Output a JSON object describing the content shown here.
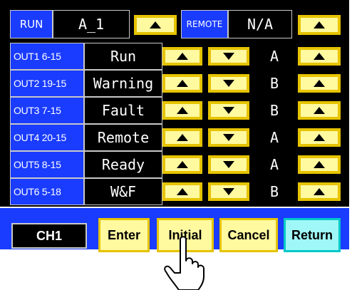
{
  "header": {
    "run_label": "RUN",
    "program_value": "A_1",
    "remote_label": "REMOTE",
    "remote_value": "N/A"
  },
  "outputs": [
    {
      "id": "OUT1",
      "code": "6-15",
      "function": "Run",
      "mode": "A"
    },
    {
      "id": "OUT2",
      "code": "19-15",
      "function": "Warning",
      "mode": "B"
    },
    {
      "id": "OUT3",
      "code": "7-15",
      "function": "Fault",
      "mode": "B"
    },
    {
      "id": "OUT4",
      "code": "20-15",
      "function": "Remote",
      "mode": "A"
    },
    {
      "id": "OUT5",
      "code": "8-15",
      "function": "Ready",
      "mode": "A"
    },
    {
      "id": "OUT6",
      "code": "5-18",
      "function": "W&F",
      "mode": "B"
    }
  ],
  "footer": {
    "channel": "CH1",
    "enter_label": "Enter",
    "initial_label": "Initial",
    "cancel_label": "Cancel",
    "return_label": "Return"
  },
  "icons": {
    "up": "up-arrow-icon",
    "down": "down-arrow-icon",
    "pointer": "hand-pointer-icon"
  },
  "colors": {
    "panel_bg": "#000000",
    "blue": "#1a3cff",
    "button_yellow": "#fff9a0",
    "button_border": "#e6c300",
    "return_cyan": "#9ff7f7"
  }
}
